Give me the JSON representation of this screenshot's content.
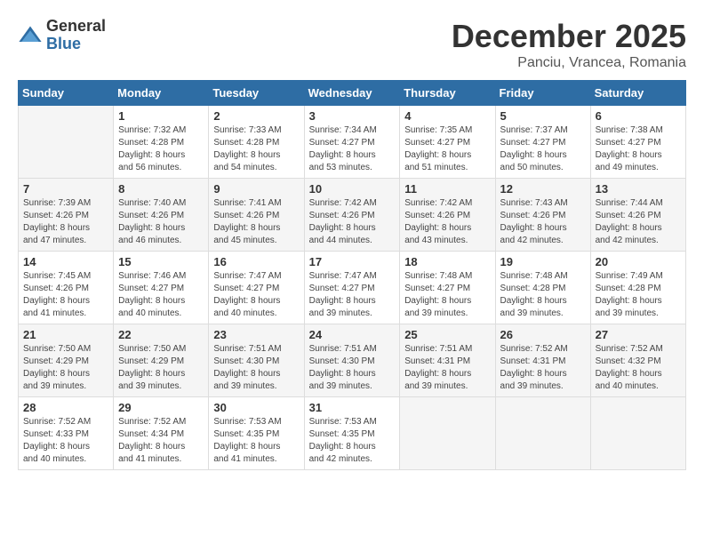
{
  "logo": {
    "general": "General",
    "blue": "Blue"
  },
  "title": "December 2025",
  "location": "Panciu, Vrancea, Romania",
  "weekdays": [
    "Sunday",
    "Monday",
    "Tuesday",
    "Wednesday",
    "Thursday",
    "Friday",
    "Saturday"
  ],
  "weeks": [
    [
      {
        "day": "",
        "info": ""
      },
      {
        "day": "1",
        "info": "Sunrise: 7:32 AM\nSunset: 4:28 PM\nDaylight: 8 hours\nand 56 minutes."
      },
      {
        "day": "2",
        "info": "Sunrise: 7:33 AM\nSunset: 4:28 PM\nDaylight: 8 hours\nand 54 minutes."
      },
      {
        "day": "3",
        "info": "Sunrise: 7:34 AM\nSunset: 4:27 PM\nDaylight: 8 hours\nand 53 minutes."
      },
      {
        "day": "4",
        "info": "Sunrise: 7:35 AM\nSunset: 4:27 PM\nDaylight: 8 hours\nand 51 minutes."
      },
      {
        "day": "5",
        "info": "Sunrise: 7:37 AM\nSunset: 4:27 PM\nDaylight: 8 hours\nand 50 minutes."
      },
      {
        "day": "6",
        "info": "Sunrise: 7:38 AM\nSunset: 4:27 PM\nDaylight: 8 hours\nand 49 minutes."
      }
    ],
    [
      {
        "day": "7",
        "info": "Sunrise: 7:39 AM\nSunset: 4:26 PM\nDaylight: 8 hours\nand 47 minutes."
      },
      {
        "day": "8",
        "info": "Sunrise: 7:40 AM\nSunset: 4:26 PM\nDaylight: 8 hours\nand 46 minutes."
      },
      {
        "day": "9",
        "info": "Sunrise: 7:41 AM\nSunset: 4:26 PM\nDaylight: 8 hours\nand 45 minutes."
      },
      {
        "day": "10",
        "info": "Sunrise: 7:42 AM\nSunset: 4:26 PM\nDaylight: 8 hours\nand 44 minutes."
      },
      {
        "day": "11",
        "info": "Sunrise: 7:42 AM\nSunset: 4:26 PM\nDaylight: 8 hours\nand 43 minutes."
      },
      {
        "day": "12",
        "info": "Sunrise: 7:43 AM\nSunset: 4:26 PM\nDaylight: 8 hours\nand 42 minutes."
      },
      {
        "day": "13",
        "info": "Sunrise: 7:44 AM\nSunset: 4:26 PM\nDaylight: 8 hours\nand 42 minutes."
      }
    ],
    [
      {
        "day": "14",
        "info": "Sunrise: 7:45 AM\nSunset: 4:26 PM\nDaylight: 8 hours\nand 41 minutes."
      },
      {
        "day": "15",
        "info": "Sunrise: 7:46 AM\nSunset: 4:27 PM\nDaylight: 8 hours\nand 40 minutes."
      },
      {
        "day": "16",
        "info": "Sunrise: 7:47 AM\nSunset: 4:27 PM\nDaylight: 8 hours\nand 40 minutes."
      },
      {
        "day": "17",
        "info": "Sunrise: 7:47 AM\nSunset: 4:27 PM\nDaylight: 8 hours\nand 39 minutes."
      },
      {
        "day": "18",
        "info": "Sunrise: 7:48 AM\nSunset: 4:27 PM\nDaylight: 8 hours\nand 39 minutes."
      },
      {
        "day": "19",
        "info": "Sunrise: 7:48 AM\nSunset: 4:28 PM\nDaylight: 8 hours\nand 39 minutes."
      },
      {
        "day": "20",
        "info": "Sunrise: 7:49 AM\nSunset: 4:28 PM\nDaylight: 8 hours\nand 39 minutes."
      }
    ],
    [
      {
        "day": "21",
        "info": "Sunrise: 7:50 AM\nSunset: 4:29 PM\nDaylight: 8 hours\nand 39 minutes."
      },
      {
        "day": "22",
        "info": "Sunrise: 7:50 AM\nSunset: 4:29 PM\nDaylight: 8 hours\nand 39 minutes."
      },
      {
        "day": "23",
        "info": "Sunrise: 7:51 AM\nSunset: 4:30 PM\nDaylight: 8 hours\nand 39 minutes."
      },
      {
        "day": "24",
        "info": "Sunrise: 7:51 AM\nSunset: 4:30 PM\nDaylight: 8 hours\nand 39 minutes."
      },
      {
        "day": "25",
        "info": "Sunrise: 7:51 AM\nSunset: 4:31 PM\nDaylight: 8 hours\nand 39 minutes."
      },
      {
        "day": "26",
        "info": "Sunrise: 7:52 AM\nSunset: 4:31 PM\nDaylight: 8 hours\nand 39 minutes."
      },
      {
        "day": "27",
        "info": "Sunrise: 7:52 AM\nSunset: 4:32 PM\nDaylight: 8 hours\nand 40 minutes."
      }
    ],
    [
      {
        "day": "28",
        "info": "Sunrise: 7:52 AM\nSunset: 4:33 PM\nDaylight: 8 hours\nand 40 minutes."
      },
      {
        "day": "29",
        "info": "Sunrise: 7:52 AM\nSunset: 4:34 PM\nDaylight: 8 hours\nand 41 minutes."
      },
      {
        "day": "30",
        "info": "Sunrise: 7:53 AM\nSunset: 4:35 PM\nDaylight: 8 hours\nand 41 minutes."
      },
      {
        "day": "31",
        "info": "Sunrise: 7:53 AM\nSunset: 4:35 PM\nDaylight: 8 hours\nand 42 minutes."
      },
      {
        "day": "",
        "info": ""
      },
      {
        "day": "",
        "info": ""
      },
      {
        "day": "",
        "info": ""
      }
    ]
  ]
}
